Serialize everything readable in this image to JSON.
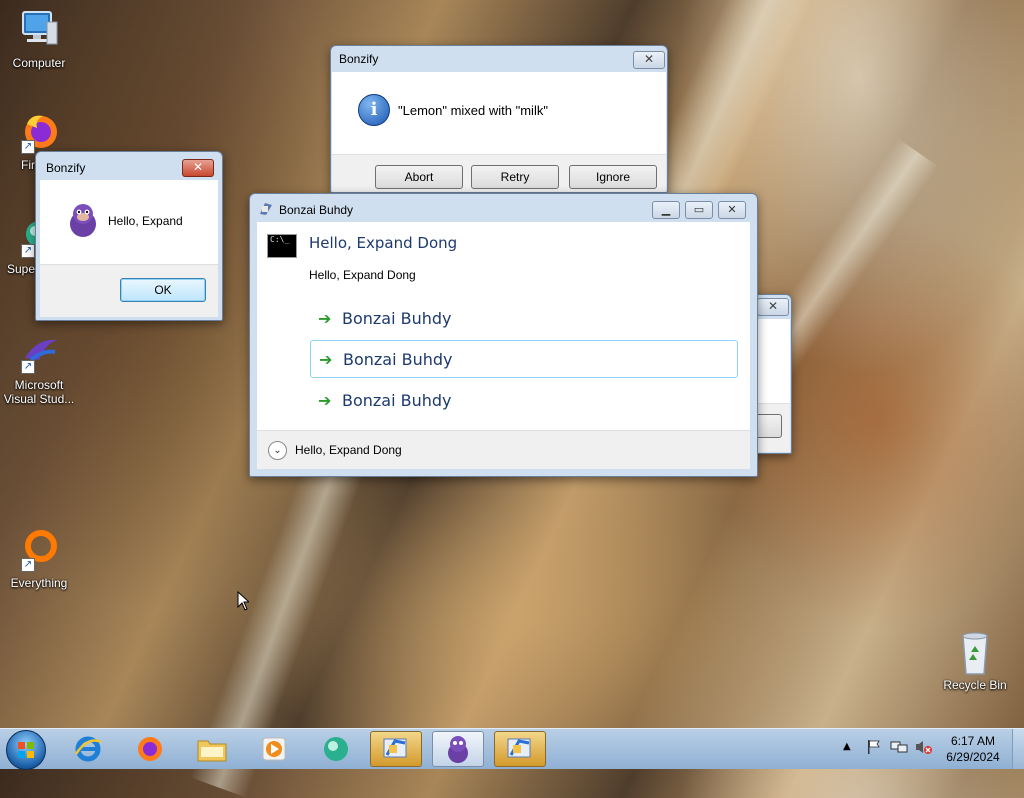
{
  "desktop": {
    "icons": [
      {
        "label": "Computer"
      },
      {
        "label": "Fir"
      },
      {
        "label": "Supe"
      },
      {
        "label": "Microsoft Visual Stud..."
      },
      {
        "label": "Everything"
      },
      {
        "label": "Recycle Bin"
      }
    ]
  },
  "dialog_abort": {
    "title": "Bonzify",
    "message": "\"Lemon\" mixed with \"milk\"",
    "buttons": [
      "Abort",
      "Retry",
      "Ignore"
    ]
  },
  "dialog_ok": {
    "title": "Bonzify",
    "message": "Hello, Expand",
    "ok_label": "OK"
  },
  "task_dialog": {
    "title": "Bonzai Buhdy",
    "heading": "Hello, Expand Dong",
    "content": "Hello, Expand Dong",
    "command_links": [
      {
        "label": "Bonzai Buhdy"
      },
      {
        "label": "Bonzai Buhdy"
      },
      {
        "label": "Bonzai Buhdy"
      }
    ],
    "expander_label": "Hello, Expand Dong"
  },
  "taskbar": {
    "items": [
      "start-orb",
      "internet-explorer",
      "firefox",
      "file-explorer",
      "media-player",
      "app-teal",
      "bonzify-active",
      "bonzi-buddy",
      "bonzify"
    ],
    "time": "6:17 AM",
    "date": "6/29/2024"
  },
  "colors": {
    "title_bar": "#cfdff0",
    "heading_blue": "#1d3a6e",
    "command_arrow": "#2b9a2b",
    "taskbar": "#9fbddc",
    "active_task": "#e0b050"
  }
}
